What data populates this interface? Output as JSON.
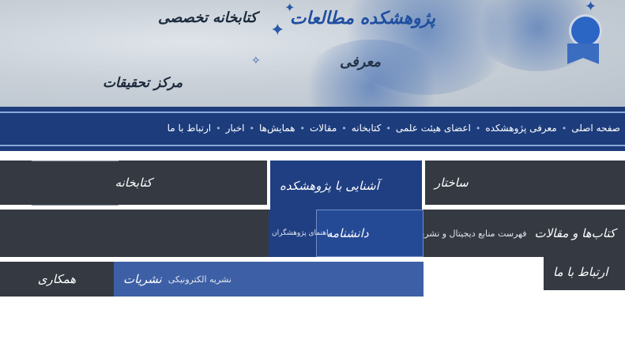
{
  "banner": {
    "title_main": "پژوهشکده مطالعات",
    "title_secondary": "کتابخانه تخصصی",
    "subtitle": "معرفی",
    "tagline": "مرکز تحقیقات"
  },
  "nav": {
    "links": [
      "صفحه اصلی",
      "معرفی پژوهشکده",
      "اعضای هیئت علمی",
      "کتابخانه",
      "مقالات",
      "همایش‌ها",
      "اخبار",
      "ارتباط با ما"
    ],
    "separator": "•"
  },
  "menu": {
    "row1_right": "ساختار",
    "row1_center": "آشنایی با پژوهشکده",
    "row1_left": "کتابخانه",
    "row2_center": "دانشنامه",
    "row2_center_sub": "راهنمای پژوهشگران",
    "row2_left_title": "کتاب‌ها و مقالات",
    "row2_left_sub": "فهرست منابع دیجیتال و نشریات تخصصی پژوهشکده",
    "row3_right": "ارتباط با ما",
    "row3_center": "نشریات",
    "row3_center_sub": "نشریه الکترونیکی",
    "row3_left": "همکاری"
  },
  "colors": {
    "nav_bg": "#1c3c7c",
    "menu_dark": "#353a42",
    "menu_blue": "#1f3f82",
    "accent": "#2c5aa8"
  }
}
